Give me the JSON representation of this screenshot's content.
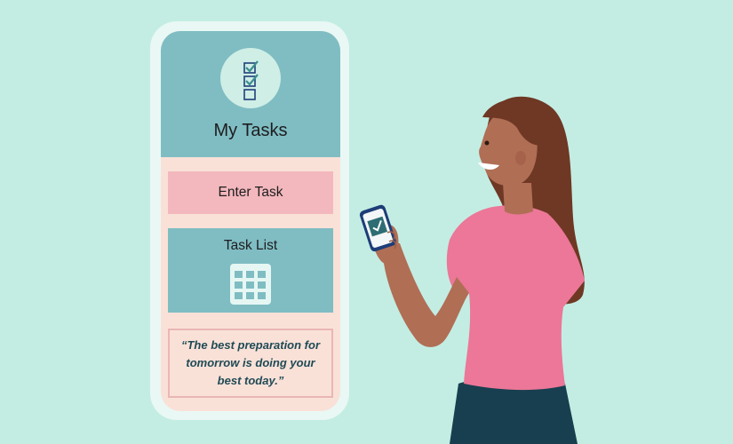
{
  "app": {
    "title": "My Tasks",
    "enter_task_label": "Enter Task",
    "task_list_label": "Task List",
    "quote": "“The best preparation for tomorrow is doing your best today.”"
  },
  "icons": {
    "app_logo": "checklist-icon",
    "task_list": "grid-icon",
    "person_phone": "checkmark-icon"
  },
  "colors": {
    "background": "#c3ede3",
    "header": "#7fbdc3",
    "enter_task": "#f3b8bd",
    "screen_body": "#f9e1d8",
    "quote_text": "#1f4a55",
    "shirt": "#ec7798",
    "hair": "#6e3824",
    "skin": "#b06e55",
    "pants": "#173f4f"
  }
}
